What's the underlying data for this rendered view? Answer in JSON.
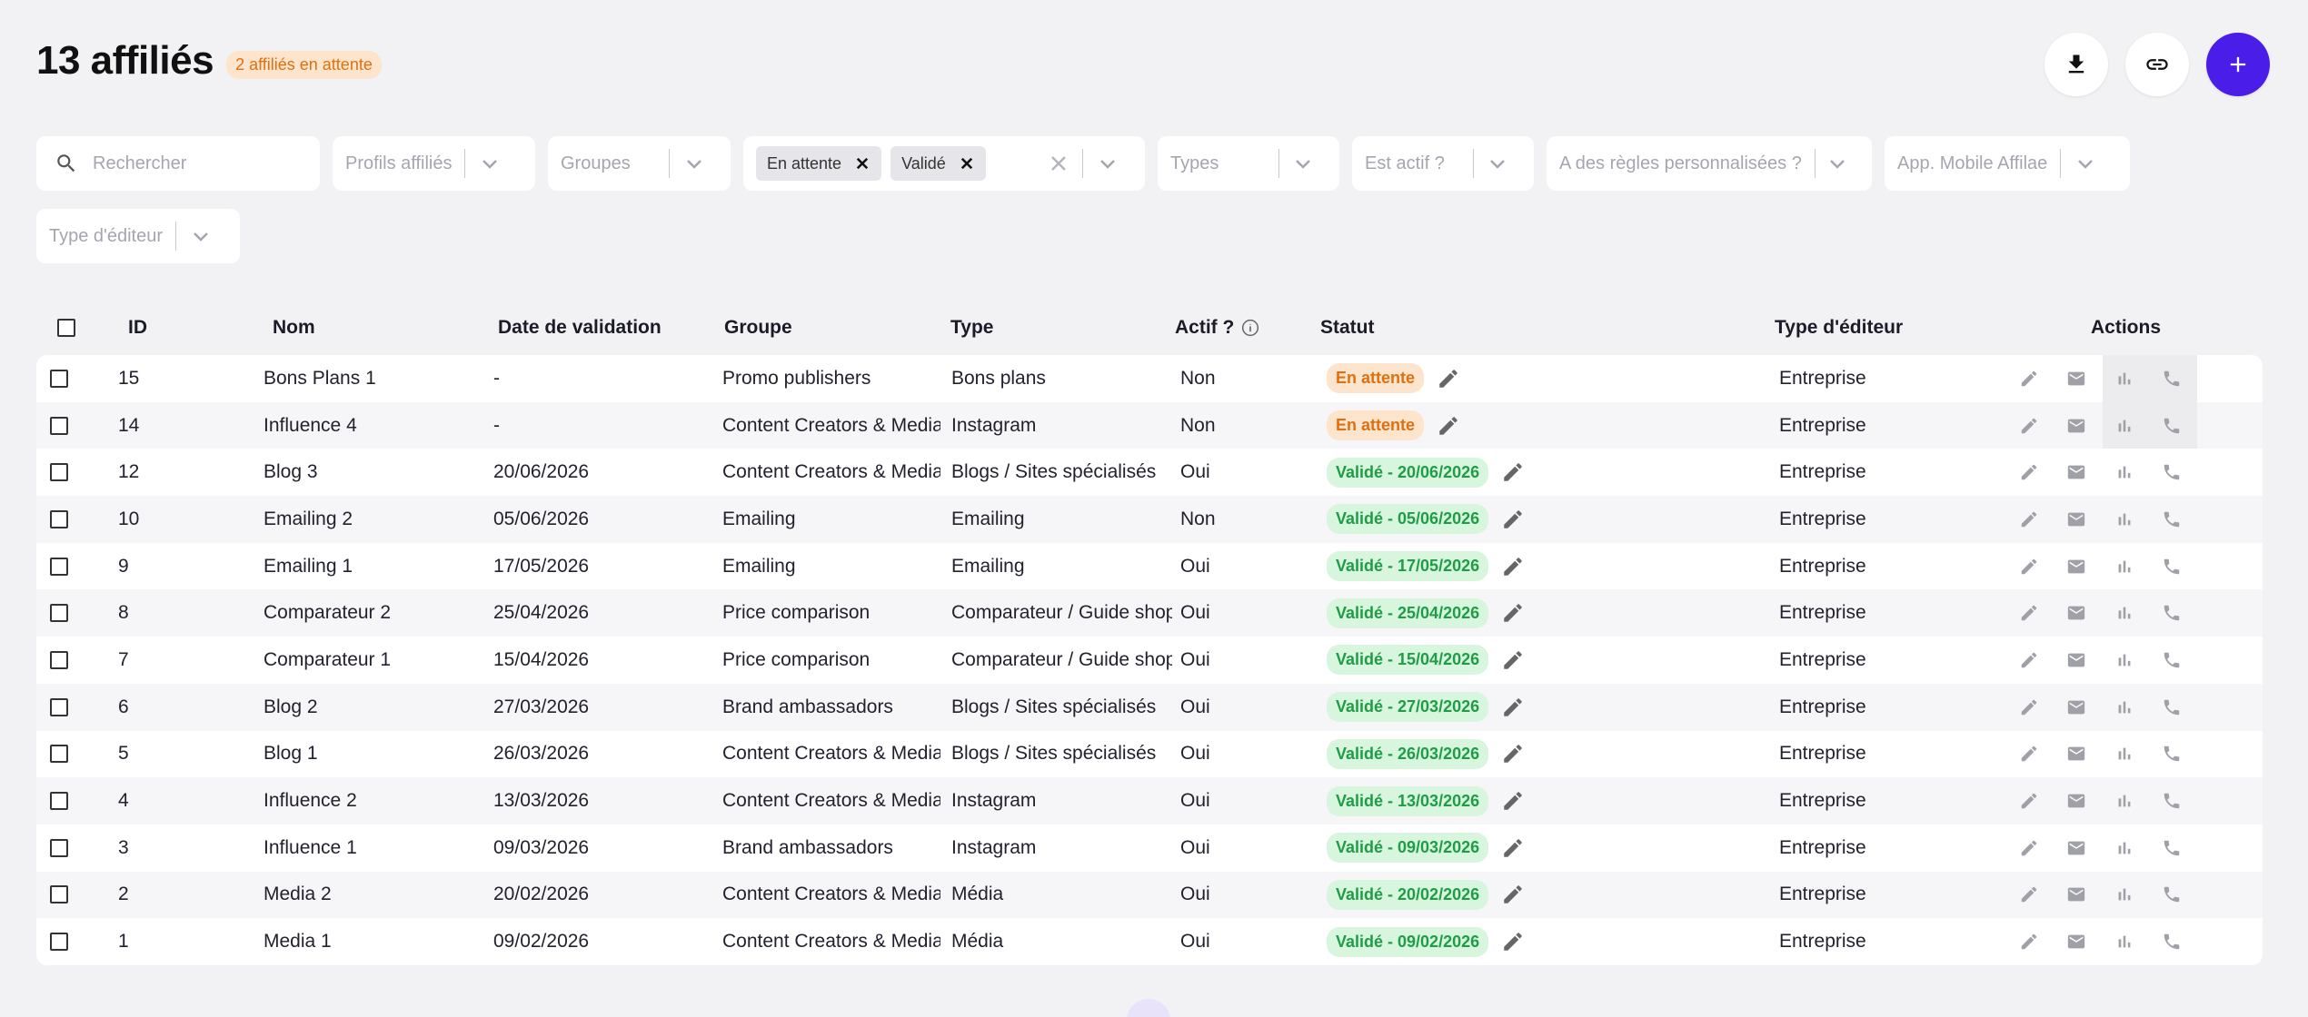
{
  "header": {
    "title": "13 affiliés",
    "pending_badge": "2 affiliés en attente"
  },
  "filters": {
    "search_placeholder": "Rechercher",
    "profils": "Profils affiliés",
    "groupes": "Groupes",
    "status_chips": [
      "En attente",
      "Validé"
    ],
    "types": "Types",
    "est_actif": "Est actif ?",
    "regles": "A des règles personnalisées ?",
    "app_mobile": "App. Mobile Affilae",
    "type_editeur": "Type d'éditeur"
  },
  "table": {
    "columns": {
      "id": "ID",
      "nom": "Nom",
      "date": "Date de validation",
      "groupe": "Groupe",
      "type": "Type",
      "actif": "Actif ?",
      "statut": "Statut",
      "type_editeur": "Type d'éditeur",
      "actions": "Actions"
    },
    "rows": [
      {
        "id": "15",
        "nom": "Bons Plans 1",
        "date": "-",
        "groupe": "Promo publishers",
        "type": "Bons plans",
        "actif": "Non",
        "statut": "En attente",
        "pending": true,
        "editeur": "Entreprise"
      },
      {
        "id": "14",
        "nom": "Influence 4",
        "date": "-",
        "groupe": "Content Creators & Media",
        "type": "Instagram",
        "actif": "Non",
        "statut": "En attente",
        "pending": true,
        "editeur": "Entreprise"
      },
      {
        "id": "12",
        "nom": "Blog 3",
        "date": "20/06/2026",
        "groupe": "Content Creators & Media",
        "type": "Blogs / Sites spécialisés",
        "actif": "Oui",
        "statut": "Validé - 20/06/2026",
        "pending": false,
        "editeur": "Entreprise"
      },
      {
        "id": "10",
        "nom": "Emailing 2",
        "date": "05/06/2026",
        "groupe": "Emailing",
        "type": "Emailing",
        "actif": "Non",
        "statut": "Validé - 05/06/2026",
        "pending": false,
        "editeur": "Entreprise"
      },
      {
        "id": "9",
        "nom": "Emailing 1",
        "date": "17/05/2026",
        "groupe": "Emailing",
        "type": "Emailing",
        "actif": "Oui",
        "statut": "Validé - 17/05/2026",
        "pending": false,
        "editeur": "Entreprise"
      },
      {
        "id": "8",
        "nom": "Comparateur 2",
        "date": "25/04/2026",
        "groupe": "Price comparison",
        "type": "Comparateur / Guide shopping",
        "actif": "Oui",
        "statut": "Validé - 25/04/2026",
        "pending": false,
        "editeur": "Entreprise"
      },
      {
        "id": "7",
        "nom": "Comparateur 1",
        "date": "15/04/2026",
        "groupe": "Price comparison",
        "type": "Comparateur / Guide shopping",
        "actif": "Oui",
        "statut": "Validé - 15/04/2026",
        "pending": false,
        "editeur": "Entreprise"
      },
      {
        "id": "6",
        "nom": "Blog 2",
        "date": "27/03/2026",
        "groupe": "Brand ambassadors",
        "type": "Blogs / Sites spécialisés",
        "actif": "Oui",
        "statut": "Validé - 27/03/2026",
        "pending": false,
        "editeur": "Entreprise"
      },
      {
        "id": "5",
        "nom": "Blog 1",
        "date": "26/03/2026",
        "groupe": "Content Creators & Media",
        "type": "Blogs / Sites spécialisés",
        "actif": "Oui",
        "statut": "Validé - 26/03/2026",
        "pending": false,
        "editeur": "Entreprise"
      },
      {
        "id": "4",
        "nom": "Influence 2",
        "date": "13/03/2026",
        "groupe": "Content Creators & Media",
        "type": "Instagram",
        "actif": "Oui",
        "statut": "Validé - 13/03/2026",
        "pending": false,
        "editeur": "Entreprise"
      },
      {
        "id": "3",
        "nom": "Influence 1",
        "date": "09/03/2026",
        "groupe": "Brand ambassadors",
        "type": "Instagram",
        "actif": "Oui",
        "statut": "Validé - 09/03/2026",
        "pending": false,
        "editeur": "Entreprise"
      },
      {
        "id": "2",
        "nom": "Media 2",
        "date": "20/02/2026",
        "groupe": "Content Creators & Media",
        "type": "Média",
        "actif": "Oui",
        "statut": "Validé - 20/02/2026",
        "pending": false,
        "editeur": "Entreprise"
      },
      {
        "id": "1",
        "nom": "Media 1",
        "date": "09/02/2026",
        "groupe": "Content Creators & Media",
        "type": "Média",
        "actif": "Oui",
        "statut": "Validé - 09/02/2026",
        "pending": false,
        "editeur": "Entreprise"
      }
    ]
  },
  "icons": {
    "download": "download-icon",
    "link": "link-icon",
    "add": "plus-icon",
    "search": "search-icon",
    "chevron": "chevron-down-icon",
    "clear": "close-icon",
    "edit": "pencil-icon",
    "mail": "mail-icon",
    "stats": "bar-chart-icon",
    "phone": "phone-icon"
  },
  "colors": {
    "primary": "#4a1de8",
    "pending_bg": "#fde4cc",
    "pending_fg": "#e0700f",
    "ok_bg": "#d8f5dd",
    "ok_fg": "#1f9d46"
  }
}
